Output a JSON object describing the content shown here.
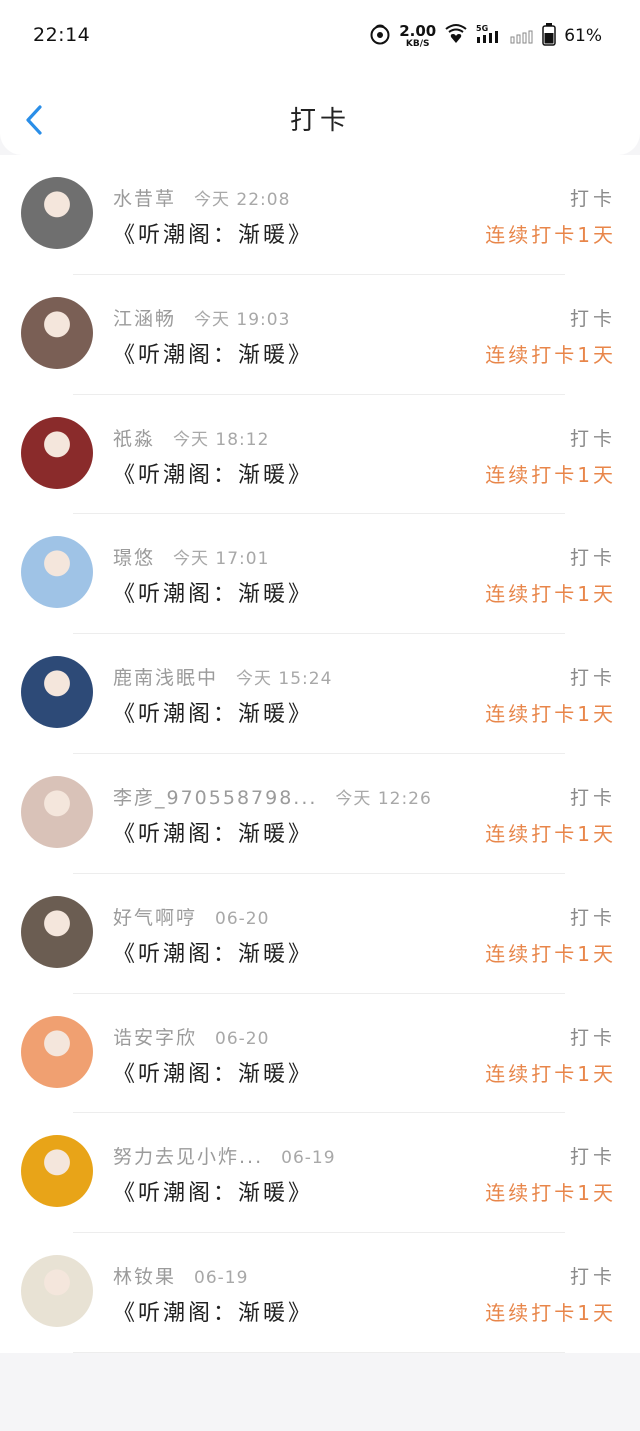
{
  "status_bar": {
    "time": "22:14",
    "net_speed_value": "2.00",
    "net_speed_unit": "KB/S",
    "network": "5G",
    "battery": "61%"
  },
  "nav": {
    "title": "打卡"
  },
  "colors": {
    "accent": "#2a8ee8",
    "streak": "#e8864a"
  },
  "items": [
    {
      "name": "水昔草",
      "time": "今天 22:08",
      "action": "打卡",
      "book": "《听潮阁：渐暖》",
      "streak": "连续打卡1天",
      "avatar_color": "#6f6f6f"
    },
    {
      "name": "江涵畅",
      "time": "今天 19:03",
      "action": "打卡",
      "book": "《听潮阁：渐暖》",
      "streak": "连续打卡1天",
      "avatar_color": "#7a5f55"
    },
    {
      "name": "祇淼",
      "time": "今天 18:12",
      "action": "打卡",
      "book": "《听潮阁：渐暖》",
      "streak": "连续打卡1天",
      "avatar_color": "#8a2b2b"
    },
    {
      "name": "璟悠",
      "time": "今天 17:01",
      "action": "打卡",
      "book": "《听潮阁：渐暖》",
      "streak": "连续打卡1天",
      "avatar_color": "#9fc3e6"
    },
    {
      "name": "鹿南浅眠中",
      "time": "今天 15:24",
      "action": "打卡",
      "book": "《听潮阁：渐暖》",
      "streak": "连续打卡1天",
      "avatar_color": "#2d4a77"
    },
    {
      "name": "李彦_970558798...",
      "time": "今天 12:26",
      "action": "打卡",
      "book": "《听潮阁：渐暖》",
      "streak": "连续打卡1天",
      "avatar_color": "#d9c2b8"
    },
    {
      "name": "好气啊哼",
      "time": "06-20",
      "action": "打卡",
      "book": "《听潮阁：渐暖》",
      "streak": "连续打卡1天",
      "avatar_color": "#6b5d52"
    },
    {
      "name": "诰安字欣",
      "time": "06-20",
      "action": "打卡",
      "book": "《听潮阁：渐暖》",
      "streak": "连续打卡1天",
      "avatar_color": "#f0a071"
    },
    {
      "name": "努力去见小炸...",
      "time": "06-19",
      "action": "打卡",
      "book": "《听潮阁：渐暖》",
      "streak": "连续打卡1天",
      "avatar_color": "#e8a418"
    },
    {
      "name": "林钕果",
      "time": "06-19",
      "action": "打卡",
      "book": "《听潮阁：渐暖》",
      "streak": "连续打卡1天",
      "avatar_color": "#e8e2d4"
    }
  ]
}
